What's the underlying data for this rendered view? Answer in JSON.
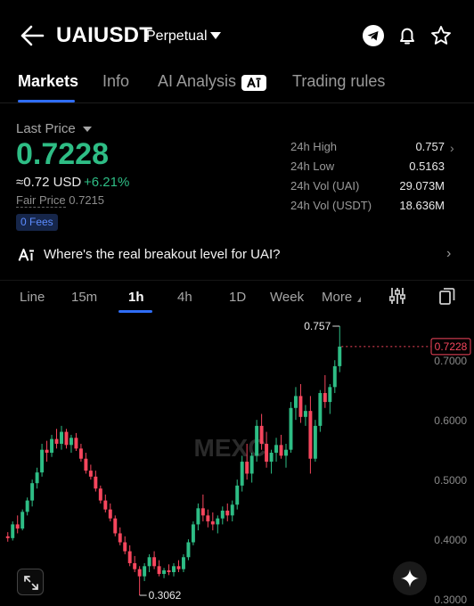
{
  "header": {
    "symbol": "UAIUSDT",
    "contract_type": "Perpetual",
    "icons": [
      "back-arrow-icon",
      "telegram-icon",
      "bell-icon",
      "star-icon"
    ]
  },
  "tabs": [
    {
      "label": "Markets",
      "active": true
    },
    {
      "label": "Info",
      "active": false
    },
    {
      "label": "AI Analysis",
      "active": false
    },
    {
      "label": "Trading rules",
      "active": false
    }
  ],
  "ticker": {
    "last_price_label": "Last Price",
    "last_price": "0.7228",
    "usd_value": "≈0.72 USD",
    "change_pct": "+6.21%",
    "fair_price_label": "Fair Price",
    "fair_price": "0.7215",
    "fees_badge": "0 Fees"
  },
  "stats": [
    {
      "label": "24h High",
      "value": "0.757"
    },
    {
      "label": "24h Low",
      "value": "0.5163"
    },
    {
      "label": "24h Vol (UAI)",
      "value": "29.073M"
    },
    {
      "label": "24h Vol (USDT)",
      "value": "18.636M"
    }
  ],
  "ai_prompt": "Where's the real breakout level for UAI?",
  "timeframes": [
    {
      "label": "Line",
      "active": false
    },
    {
      "label": "15m",
      "active": false
    },
    {
      "label": "1h",
      "active": true
    },
    {
      "label": "4h",
      "active": false
    },
    {
      "label": "1D",
      "active": false
    },
    {
      "label": "Week",
      "active": false
    },
    {
      "label": "More",
      "active": false
    }
  ],
  "colors": {
    "up": "#2ebd85",
    "down": "#f6465d",
    "accent": "#2f6df6"
  },
  "chart_data": {
    "type": "candlestick",
    "y_ticks": [
      "0.7000",
      "0.6000",
      "0.5000",
      "0.4000",
      "0.3000"
    ],
    "ylim": [
      0.3,
      0.77
    ],
    "current_price_label": "0.7228",
    "current_price": 0.7228,
    "high_marker": {
      "label": "0.757",
      "value": 0.757
    },
    "low_marker": {
      "label": "0.3062",
      "value": 0.3062
    },
    "watermark": "MEXC",
    "candles": [
      [
        0.405,
        0.412,
        0.396,
        0.402
      ],
      [
        0.402,
        0.43,
        0.398,
        0.425
      ],
      [
        0.425,
        0.44,
        0.41,
        0.418
      ],
      [
        0.418,
        0.45,
        0.415,
        0.446
      ],
      [
        0.446,
        0.47,
        0.44,
        0.465
      ],
      [
        0.465,
        0.5,
        0.455,
        0.494
      ],
      [
        0.494,
        0.52,
        0.485,
        0.512
      ],
      [
        0.512,
        0.56,
        0.505,
        0.55
      ],
      [
        0.55,
        0.565,
        0.53,
        0.545
      ],
      [
        0.545,
        0.575,
        0.538,
        0.568
      ],
      [
        0.568,
        0.585,
        0.552,
        0.56
      ],
      [
        0.56,
        0.59,
        0.55,
        0.58
      ],
      [
        0.58,
        0.585,
        0.552,
        0.558
      ],
      [
        0.558,
        0.575,
        0.545,
        0.57
      ],
      [
        0.57,
        0.578,
        0.548,
        0.552
      ],
      [
        0.552,
        0.56,
        0.53,
        0.535
      ],
      [
        0.535,
        0.545,
        0.51,
        0.515
      ],
      [
        0.515,
        0.525,
        0.5,
        0.505
      ],
      [
        0.505,
        0.515,
        0.48,
        0.485
      ],
      [
        0.485,
        0.49,
        0.46,
        0.465
      ],
      [
        0.465,
        0.475,
        0.445,
        0.45
      ],
      [
        0.45,
        0.46,
        0.43,
        0.435
      ],
      [
        0.435,
        0.44,
        0.405,
        0.41
      ],
      [
        0.41,
        0.42,
        0.39,
        0.395
      ],
      [
        0.395,
        0.405,
        0.375,
        0.38
      ],
      [
        0.38,
        0.39,
        0.355,
        0.36
      ],
      [
        0.36,
        0.372,
        0.345,
        0.35
      ],
      [
        0.35,
        0.355,
        0.3062,
        0.338
      ],
      [
        0.338,
        0.36,
        0.33,
        0.355
      ],
      [
        0.355,
        0.375,
        0.345,
        0.37
      ],
      [
        0.37,
        0.38,
        0.35,
        0.355
      ],
      [
        0.355,
        0.365,
        0.338,
        0.342
      ],
      [
        0.342,
        0.352,
        0.335,
        0.348
      ],
      [
        0.348,
        0.358,
        0.34,
        0.345
      ],
      [
        0.345,
        0.36,
        0.338,
        0.355
      ],
      [
        0.355,
        0.365,
        0.345,
        0.35
      ],
      [
        0.35,
        0.375,
        0.345,
        0.37
      ],
      [
        0.37,
        0.4,
        0.365,
        0.395
      ],
      [
        0.395,
        0.43,
        0.39,
        0.425
      ],
      [
        0.425,
        0.46,
        0.415,
        0.452
      ],
      [
        0.452,
        0.475,
        0.43,
        0.44
      ],
      [
        0.44,
        0.45,
        0.42,
        0.43
      ],
      [
        0.43,
        0.445,
        0.415,
        0.425
      ],
      [
        0.425,
        0.44,
        0.41,
        0.435
      ],
      [
        0.435,
        0.455,
        0.425,
        0.448
      ],
      [
        0.448,
        0.46,
        0.43,
        0.44
      ],
      [
        0.44,
        0.465,
        0.43,
        0.458
      ],
      [
        0.458,
        0.5,
        0.45,
        0.49
      ],
      [
        0.49,
        0.54,
        0.48,
        0.53
      ],
      [
        0.53,
        0.56,
        0.5,
        0.51
      ],
      [
        0.51,
        0.545,
        0.495,
        0.54
      ],
      [
        0.54,
        0.6,
        0.53,
        0.59
      ],
      [
        0.59,
        0.61,
        0.55,
        0.56
      ],
      [
        0.56,
        0.58,
        0.52,
        0.53
      ],
      [
        0.53,
        0.55,
        0.51,
        0.545
      ],
      [
        0.545,
        0.57,
        0.53,
        0.558
      ],
      [
        0.558,
        0.575,
        0.535,
        0.54
      ],
      [
        0.54,
        0.56,
        0.52,
        0.55
      ],
      [
        0.55,
        0.63,
        0.545,
        0.62
      ],
      [
        0.62,
        0.655,
        0.6,
        0.64
      ],
      [
        0.64,
        0.66,
        0.595,
        0.605
      ],
      [
        0.605,
        0.625,
        0.59,
        0.615
      ],
      [
        0.615,
        0.64,
        0.51,
        0.535
      ],
      [
        0.535,
        0.6,
        0.53,
        0.59
      ],
      [
        0.59,
        0.65,
        0.58,
        0.645
      ],
      [
        0.645,
        0.675,
        0.62,
        0.63
      ],
      [
        0.63,
        0.66,
        0.61,
        0.655
      ],
      [
        0.655,
        0.7,
        0.645,
        0.69
      ],
      [
        0.69,
        0.757,
        0.68,
        0.7228
      ]
    ]
  }
}
